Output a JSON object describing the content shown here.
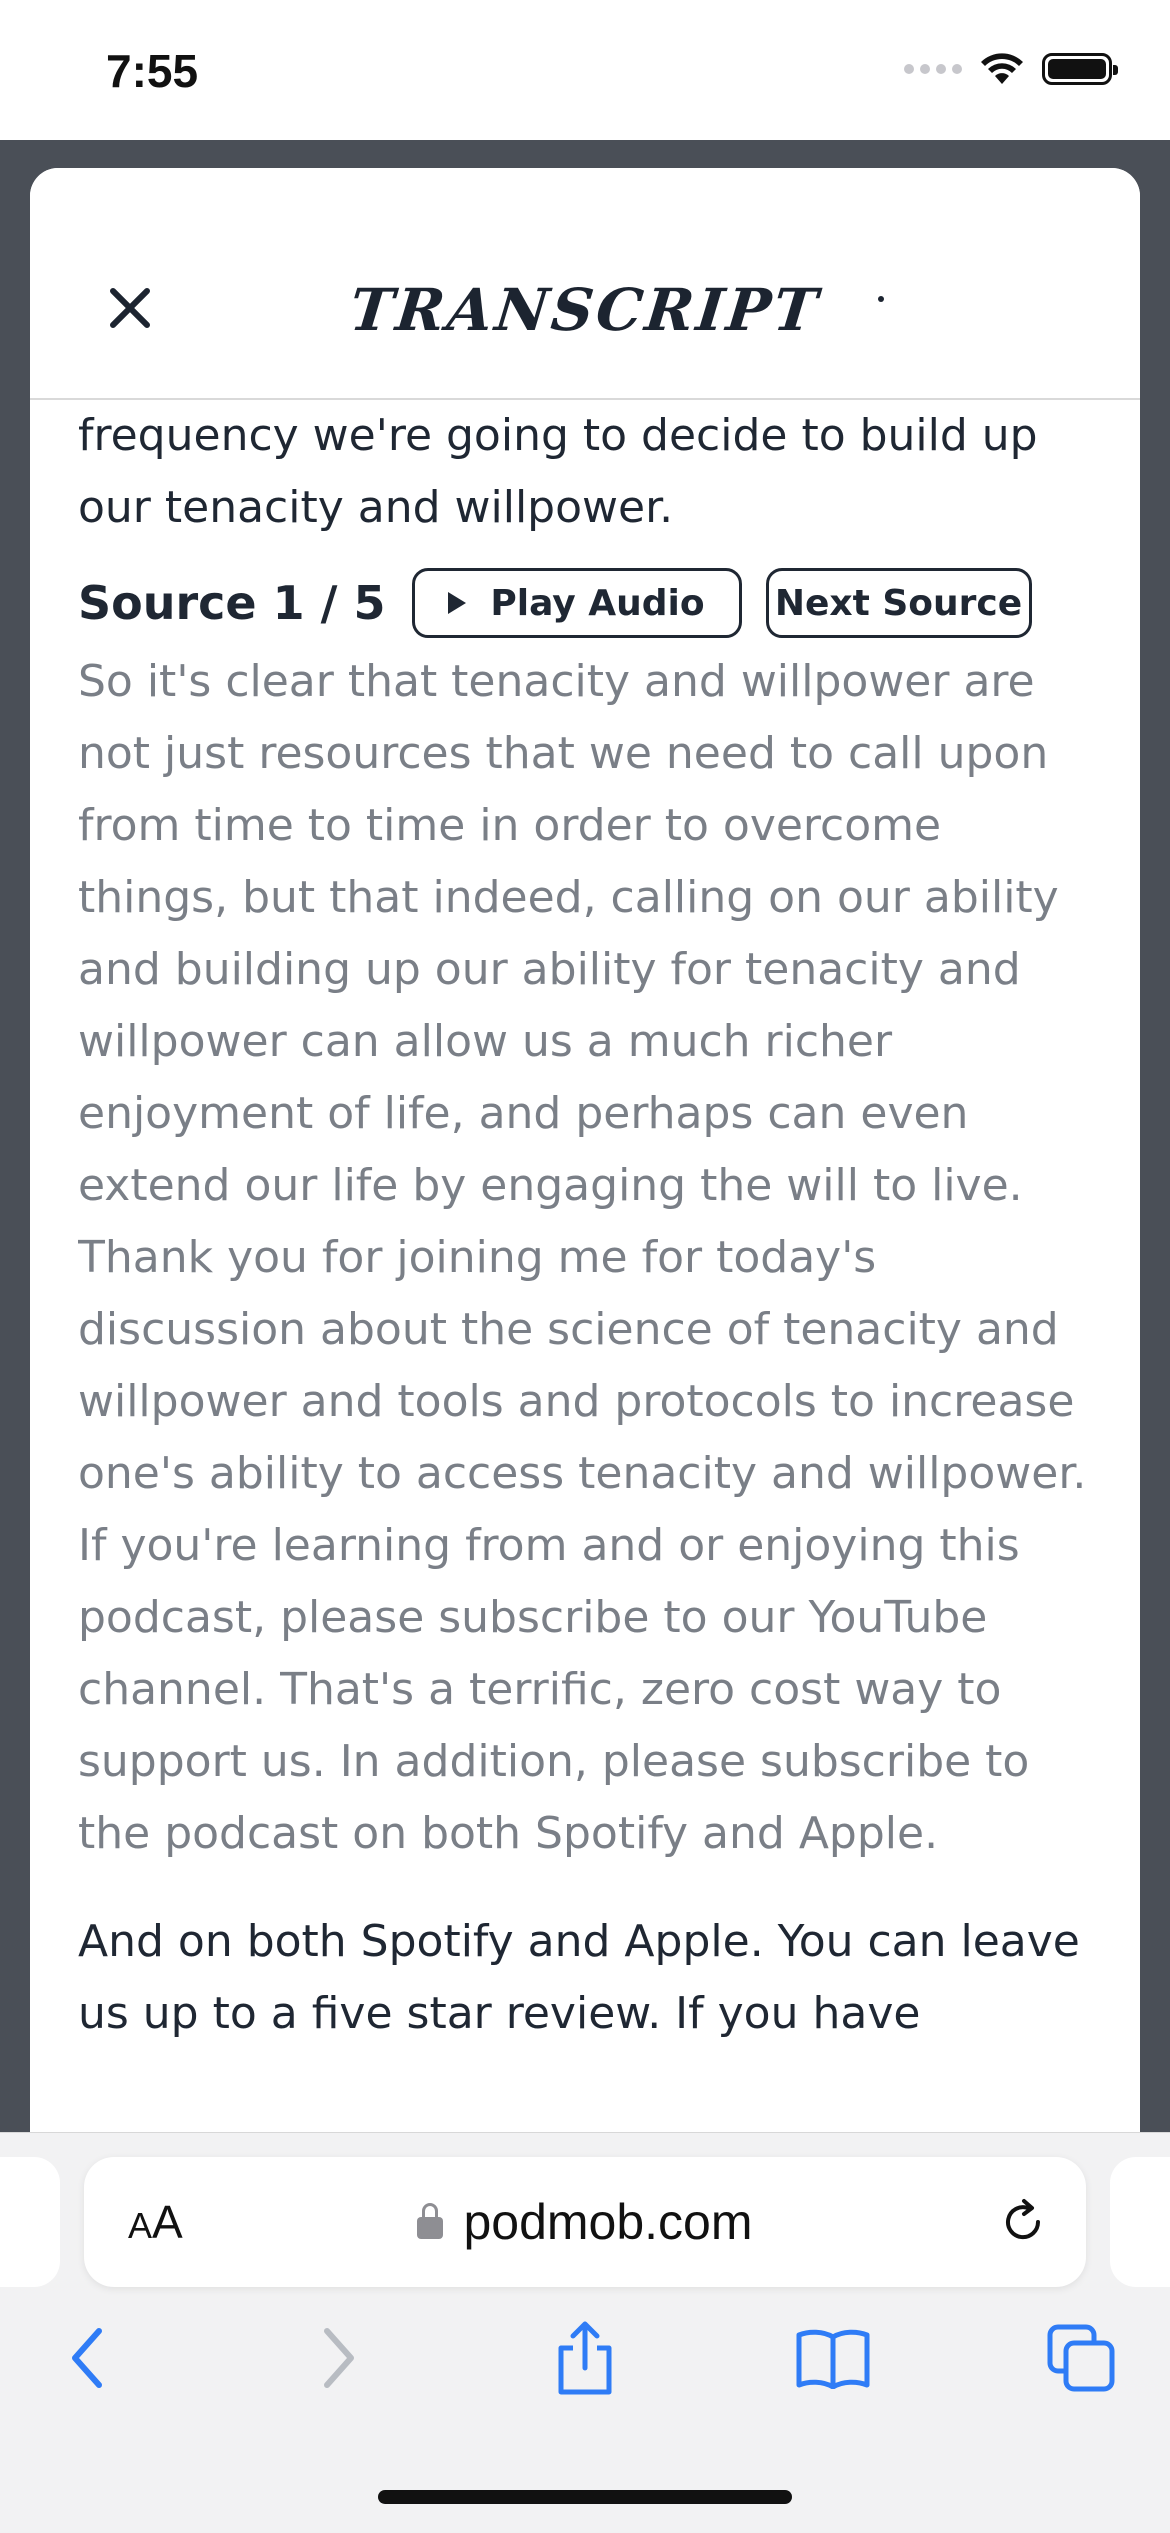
{
  "status_bar": {
    "time": "7:55"
  },
  "modal": {
    "title": "Transcript",
    "close_icon": "close-icon"
  },
  "transcript": {
    "lead_text": "frequency we're going to decide to build up our tenacity and willpower.",
    "source": {
      "label": "Source 1 / 5",
      "play_label": "Play Audio",
      "next_label": "Next Source",
      "text": "So it's clear that tenacity and willpower are not just resources that we need to call upon from time to time in order to overcome things, but that indeed, calling on our ability and building up our ability for tenacity and willpower can allow us a much richer enjoyment of life, and perhaps can even extend our life by engaging the will to live. Thank you for joining me for today's discussion about the science of tenacity and willpower and tools and protocols to increase one's ability to access tenacity and willpower. If you're learning from and or enjoying this podcast, please subscribe to our YouTube channel. That's a terrific, zero cost way to support us. In addition, please subscribe to the podcast on both Spotify and Apple."
    },
    "following_text": "And on both Spotify and Apple. You can leave us up to a five star review. If you have"
  },
  "browser": {
    "text_size_label_small": "A",
    "text_size_label_large": "A",
    "url": "podmob.com",
    "colors": {
      "accent": "#2f7cf6",
      "disabled": "#b8bcc2"
    }
  }
}
